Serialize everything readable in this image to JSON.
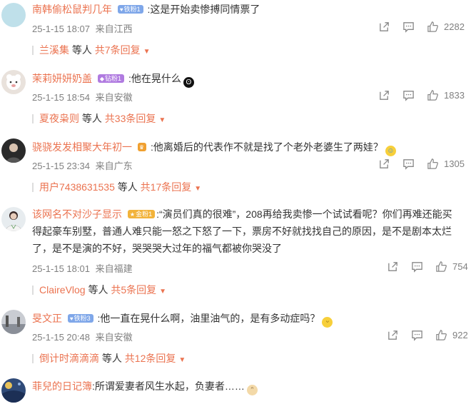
{
  "comments": [
    {
      "username": "南韩偷松鼠判几年",
      "badge": {
        "text": "铁粉1",
        "color": "#7fa7e9"
      },
      "text": ":这是开始卖惨搏同情票了",
      "date": "25-1-15 18:07",
      "location": "来自江西",
      "likes": "2282",
      "reply_users": "兰溪集",
      "reply_suffix": "等人",
      "reply_count": "共7条回复"
    },
    {
      "username": "茉莉妍妍奶盖",
      "badge": {
        "text": "钻粉1",
        "color": "#b07be0"
      },
      "text": ":他在晃什么",
      "emoji": "black-face-emoji",
      "date": "25-1-15 18:54",
      "location": "来自安徽",
      "likes": "1833",
      "reply_users": "夏夜枭则",
      "reply_suffix": "等人",
      "reply_count": "共33条回复"
    },
    {
      "username": "骁骁发发相聚大年初一",
      "badge": {
        "text": "",
        "color": "#f0a030"
      },
      "text": ":他离婚后的代表作不就是找了个老外老婆生了两娃？",
      "emoji": "laugh-cry-emoji",
      "date": "25-1-15 23:34",
      "location": "来自广东",
      "likes": "1305",
      "reply_users": "用户7438631535",
      "reply_suffix": "等人",
      "reply_count": "共17条回复"
    },
    {
      "username": "该网名不对沙子显示",
      "badge": {
        "text": "金粉1",
        "color": "#f2b33a"
      },
      "lines": [
        ":“演员们真的很难”，208再给我卖惨一个试试看呢？你们再难还能买",
        "得起豪车别墅，普通人难只能一怒之下怒了一下，票房不好就找找自己的原因，是不是剧本太烂",
        "了，是不是演的不好，哭哭哭大过年的福气都被你哭没了"
      ],
      "date": "25-1-15 18:01",
      "location": "来自福建",
      "likes": "754",
      "reply_users": "ClaireVlog",
      "reply_suffix": "等人",
      "reply_count": "共5条回复"
    },
    {
      "username": "旻文正",
      "badge": {
        "text": "铁粉3",
        "color": "#7fa7e9"
      },
      "text": ":他一直在晃什么啊，油里油气的，是有多动症吗？",
      "emoji": "smirk-emoji",
      "date": "25-1-15 20:48",
      "location": "来自安徽",
      "likes": "922",
      "reply_users": "倒计时滴滴滴",
      "reply_suffix": "等人",
      "reply_count": "共12条回复"
    },
    {
      "username": "菲兒的日记簿",
      "text": ":所谓爱妻者风生水起，负妻者……",
      "emoji": "cat-emoji"
    }
  ],
  "colors": {
    "accent": "#eb7350",
    "meta": "#808080"
  }
}
